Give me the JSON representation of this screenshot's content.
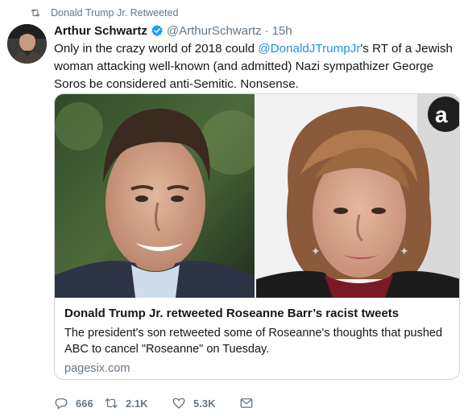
{
  "retweet_context": {
    "label": "Donald Trump Jr. Retweeted"
  },
  "tweet": {
    "display_name": "Arthur Schwartz",
    "handle": "@ArthurSchwartz",
    "separator": "·",
    "time": "15h",
    "text_before": "Only in the crazy world of 2018 could ",
    "mention": "@DonaldJTrumpJr",
    "text_after": "'s RT of a Jewish woman attacking well-known (and admitted) Nazi sympathizer George Soros be considered anti-Semitic. Nonsense."
  },
  "card": {
    "title": "Donald Trump Jr. retweeted Roseanne Barr’s racist tweets",
    "description": "The president's son retweeted some of Roseanne's thoughts that pushed ABC to cancel \"Roseanne\" on Tuesday.",
    "domain": "pagesix.com"
  },
  "actions": {
    "replies": "666",
    "retweets": "2.1K",
    "likes": "5.3K"
  },
  "colors": {
    "link": "#1b95e0",
    "secondary": "#657786",
    "border": "#ccd6dd",
    "verified": "#1da1f2"
  }
}
